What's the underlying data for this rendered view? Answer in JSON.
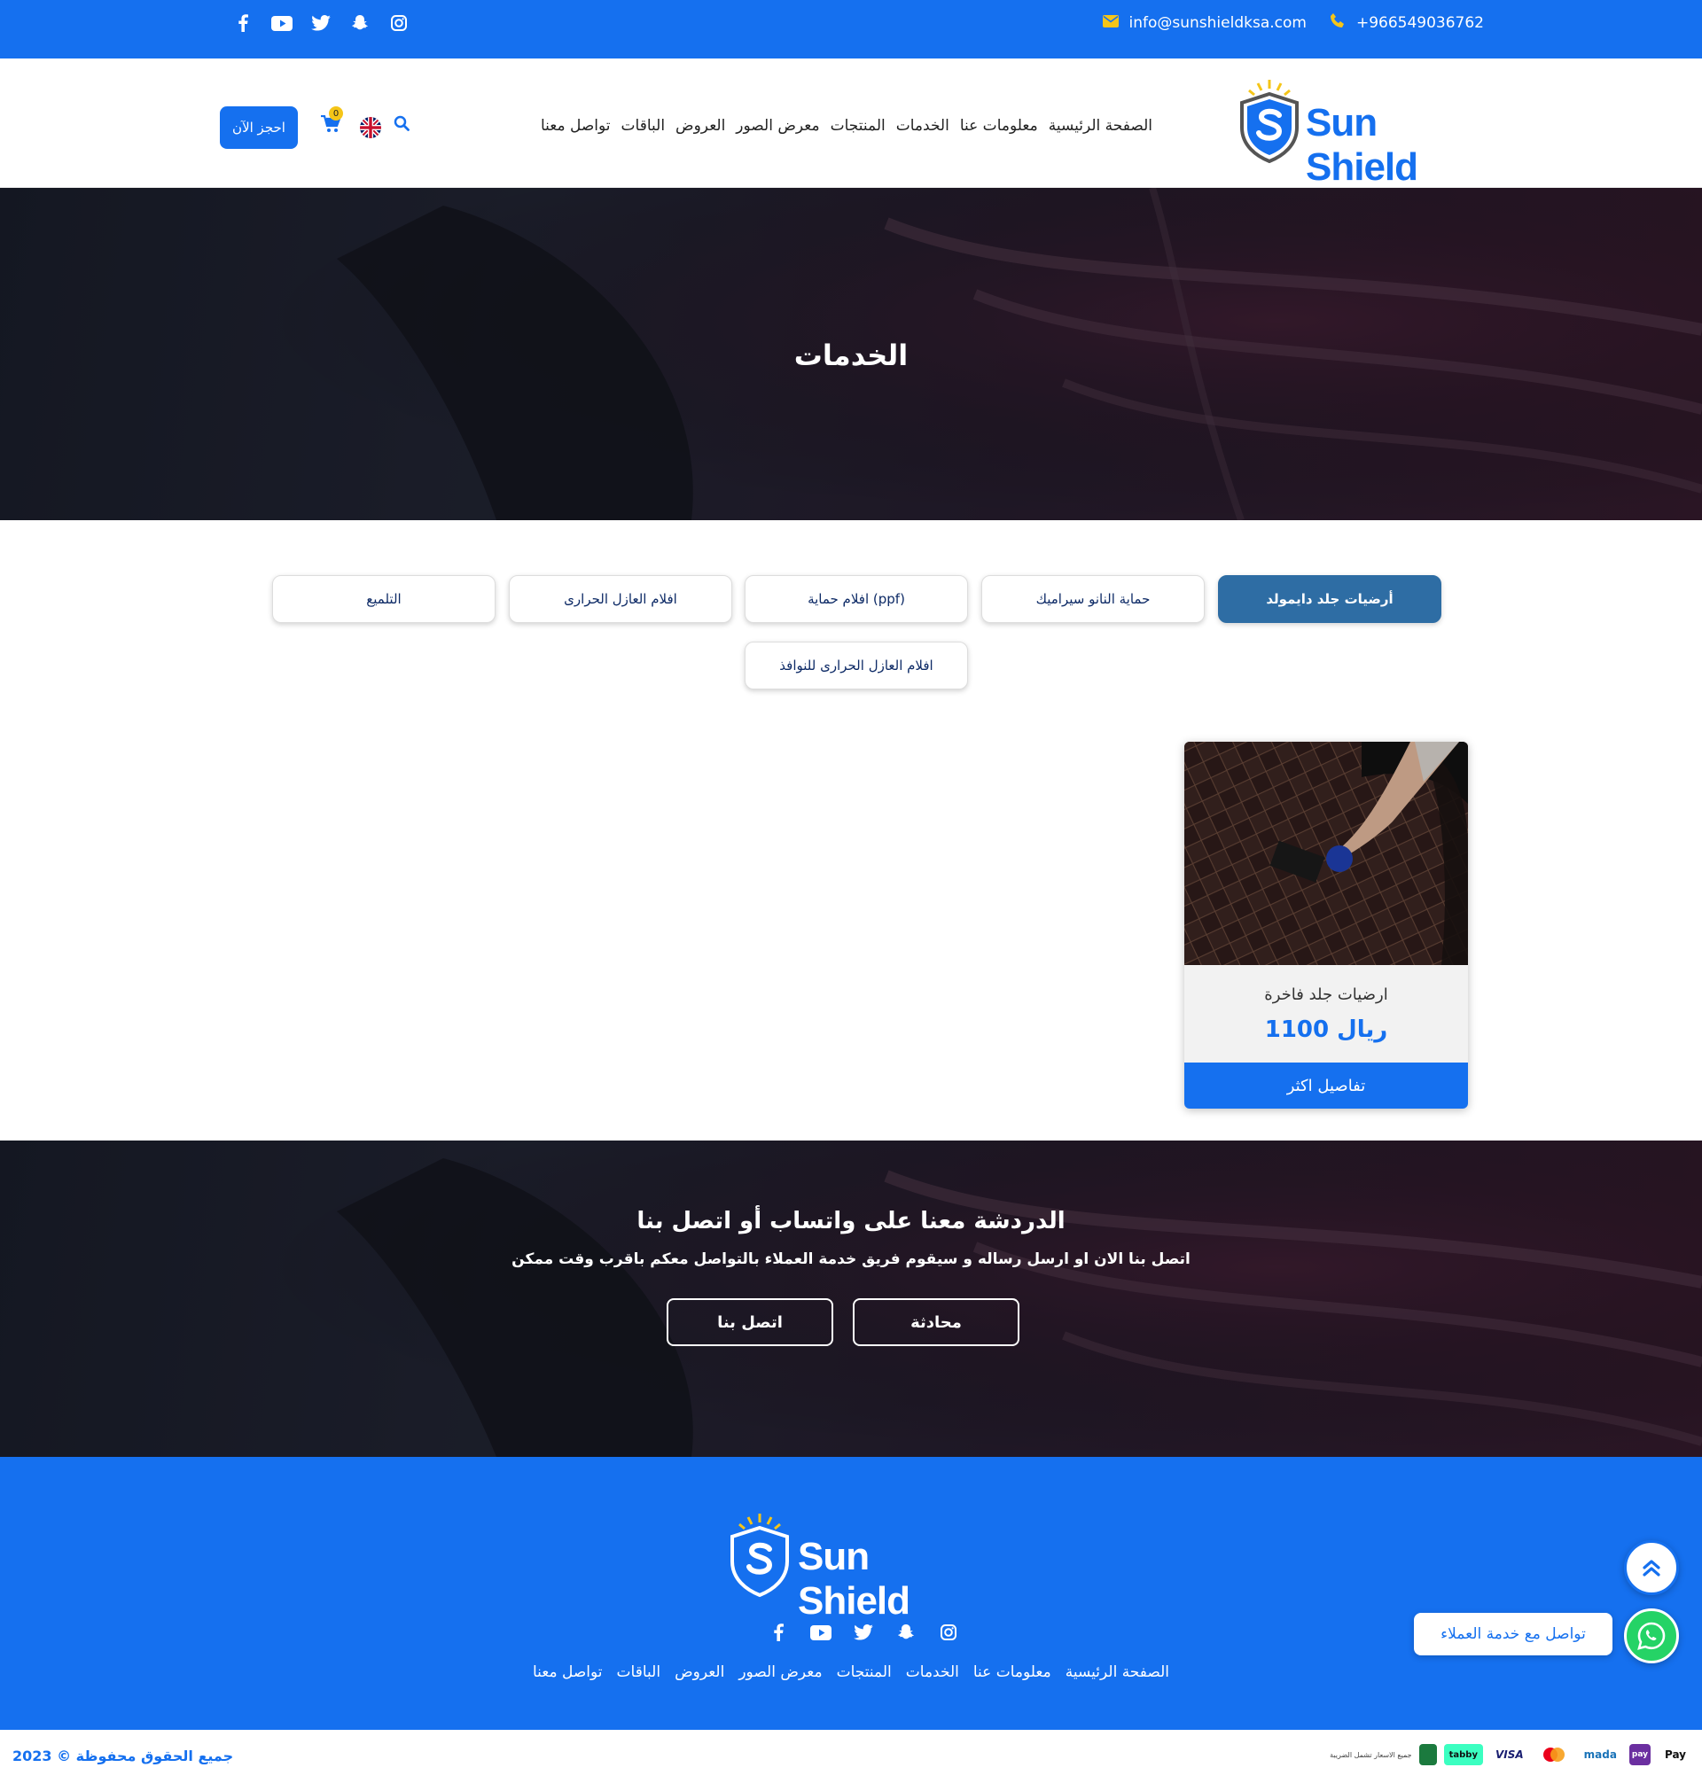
{
  "topbar": {
    "email": "info@sunshieldksa.com",
    "phone": "+966549036762",
    "socials": [
      "facebook-icon",
      "youtube-icon",
      "twitter-icon",
      "snapchat-icon",
      "instagram-icon"
    ]
  },
  "header": {
    "logo_text": "Sun Shield",
    "nav": [
      "الصفحة الرئيسية",
      "معلومات عنا",
      "الخدمات",
      "المنتجات",
      "معرض الصور",
      "العروض",
      "الباقات",
      "تواصل معنا"
    ],
    "book_label": "احجز الآن",
    "cart_count": "0"
  },
  "hero": {
    "title": "الخدمات"
  },
  "tabs": [
    {
      "label": "أرضيات جلد دايمولد",
      "active": true
    },
    {
      "label": "حماية النانو سيراميك",
      "active": false
    },
    {
      "label": "افلام حماية (ppf)",
      "active": false
    },
    {
      "label": "افلام العازل الحرارى",
      "active": false
    },
    {
      "label": "التلميع",
      "active": false
    },
    {
      "label": "افلام العازل الحرارى للنوافذ",
      "active": false
    }
  ],
  "product": {
    "name": "ارضيات جلد فاخرة",
    "price": "1100 ريال",
    "button": "تفاصيل اكثر"
  },
  "cta": {
    "title": "الدردشة معنا على واتساب أو اتصل بنا",
    "subtitle": "اتصل بنا الان او ارسل رساله و سيقوم فريق خدمة العملاء بالتواصل معكم باقرب وقت ممكن",
    "chat_label": "محادثة",
    "call_label": "اتصل بنا"
  },
  "footer": {
    "logo_text": "Sun Shield",
    "nav": [
      "الصفحة الرئيسية",
      "معلومات عنا",
      "الخدمات",
      "المنتجات",
      "معرض الصور",
      "العروض",
      "الباقات",
      "تواصل معنا"
    ]
  },
  "bottom": {
    "copyright": "جميع الحقوق محفوظة © 2023",
    "payments": [
      "Pay",
      "mada",
      "VISA",
      "tabby"
    ],
    "payment_note": "جميع الاسعار تشمل الضريبة"
  },
  "floating": {
    "whatsapp_label": "تواصل مع خدمة العملاء"
  },
  "colors": {
    "brand": "#1570ef",
    "accent": "#f5c518",
    "whatsapp": "#25d366"
  }
}
